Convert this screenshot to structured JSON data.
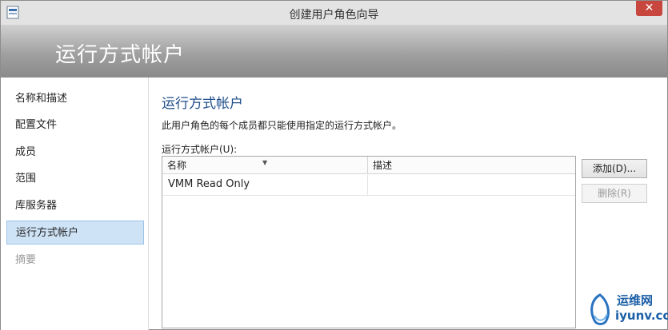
{
  "window": {
    "title": "创建用户角色向导",
    "close_glyph": "✕"
  },
  "header": {
    "title": "运行方式帐户"
  },
  "nav": {
    "items": [
      {
        "label": "名称和描述",
        "state": "normal"
      },
      {
        "label": "配置文件",
        "state": "normal"
      },
      {
        "label": "成员",
        "state": "normal"
      },
      {
        "label": "范围",
        "state": "normal"
      },
      {
        "label": "库服务器",
        "state": "normal"
      },
      {
        "label": "运行方式帐户",
        "state": "active"
      },
      {
        "label": "摘要",
        "state": "disabled"
      }
    ]
  },
  "main": {
    "heading": "运行方式帐户",
    "description": "此用户角色的每个成员都只能使用指定的运行方式帐户。",
    "list_label": "运行方式帐户(U):",
    "columns": [
      "名称",
      "描述"
    ],
    "rows": [
      {
        "name": "VMM Read Only",
        "description": ""
      }
    ],
    "buttons": {
      "add": "添加(D)...",
      "remove": "删除(R)"
    }
  },
  "watermark": {
    "cn": "运维网",
    "en": "iyunv.com"
  },
  "colors": {
    "accent_heading": "#1f4e8c",
    "selected_nav": "#cfe3f7",
    "close_button": "#c7473e"
  }
}
